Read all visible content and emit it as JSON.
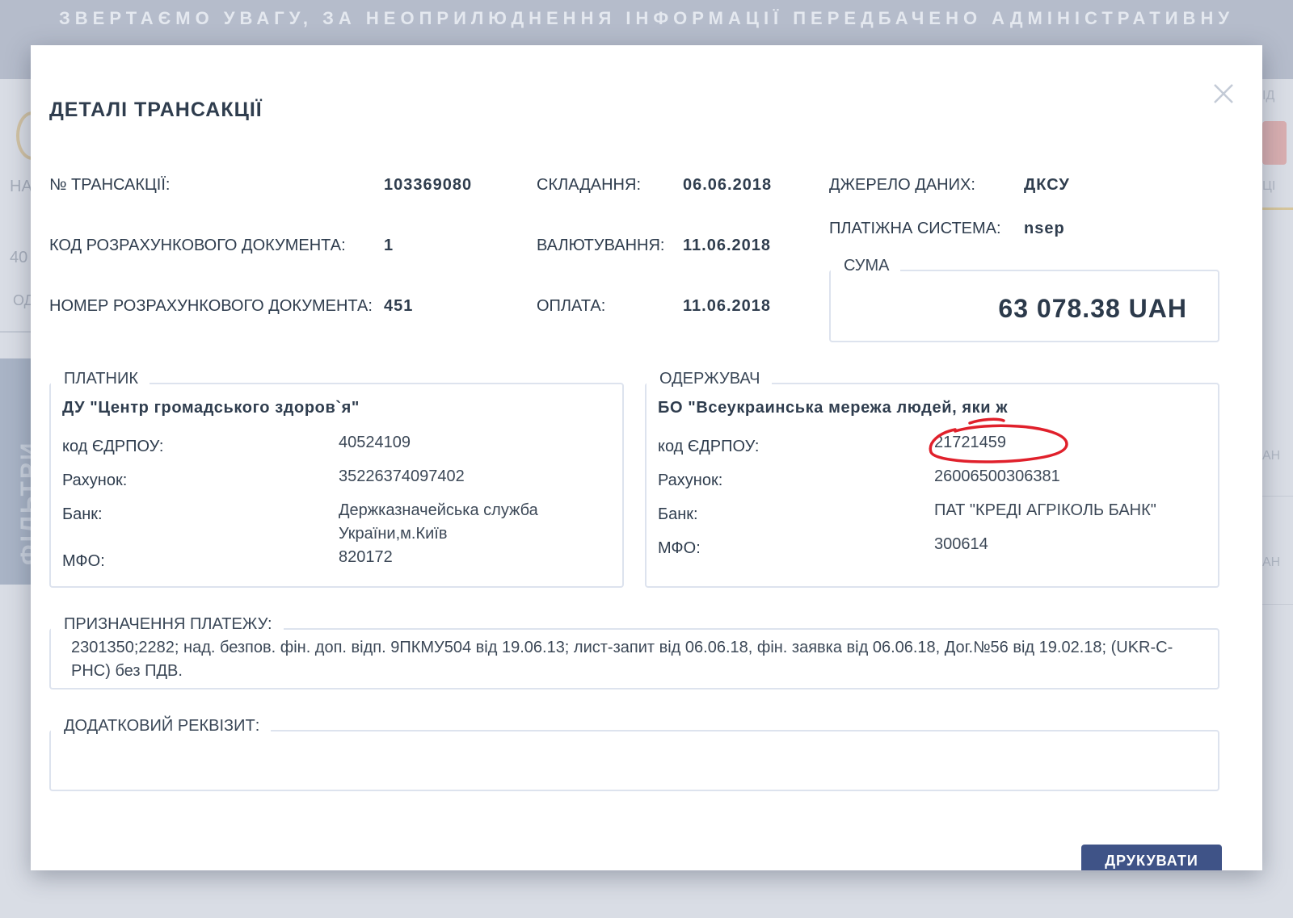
{
  "background": {
    "banner_text": "ЗВЕРТАЄМО УВАГУ, ЗА НЕОПРИЛЮДНЕННЯ ІНФОРМАЦІЇ ПЕРЕДБАЧЕНО АДМІНІСТРАТИВНУ",
    "filter_tab_label": "ФІЛЬТРИ",
    "left_snippets": [
      "НА",
      "40",
      "ОД"
    ],
    "right_snippets": [
      "ІД",
      "ЦІ",
      "АН",
      "АН"
    ]
  },
  "modal": {
    "title": "ДЕТАЛІ ТРАНСАКЦІЇ",
    "close_icon": "close-icon",
    "fields": {
      "transaction_no": {
        "label": "№ ТРАНСАКЦІЇ:",
        "value": "103369080"
      },
      "doc_code": {
        "label": "КОД РОЗРАХУНКОВОГО ДОКУМЕНТА:",
        "value": "1"
      },
      "doc_number": {
        "label": "НОМЕР РОЗРАХУНКОВОГО ДОКУМЕНТА:",
        "value": "451"
      },
      "drafted": {
        "label": "СКЛАДАННЯ:",
        "value": "06.06.2018"
      },
      "value_date": {
        "label": "ВАЛЮТУВАННЯ:",
        "value": "11.06.2018"
      },
      "payment": {
        "label": "ОПЛАТА:",
        "value": "11.06.2018"
      },
      "data_source": {
        "label": "ДЖЕРЕЛО ДАНИХ:",
        "value": "ДКСУ"
      },
      "payment_system": {
        "label": "ПЛАТІЖНА СИСТЕМА:",
        "value": "nsep"
      }
    },
    "amount": {
      "legend": "СУМА",
      "value": "63 078.38 UAH"
    },
    "payer": {
      "legend": "ПЛАТНИК",
      "name": "ДУ \"Центр громадського здоров`я\"",
      "edrpou_label": "код ЄДРПОУ:",
      "edrpou": "40524109",
      "account_label": "Рахунок:",
      "account": "35226374097402",
      "bank_label": "Банк:",
      "bank_line1": "Держказначейська служба",
      "bank_line2": "України,м.Київ",
      "mfo_label": "МФО:",
      "mfo": "820172"
    },
    "recipient": {
      "legend": "ОДЕРЖУВАЧ",
      "name": "БО \"Всеукраинська мережа людей, яки ж",
      "edrpou_label": "код ЄДРПОУ:",
      "edrpou": "21721459",
      "account_label": "Рахунок:",
      "account": "26006500306381",
      "bank_label": "Банк:",
      "bank": "ПАТ \"КРЕДІ АГРІКОЛЬ БАНК\"",
      "mfo_label": "МФО:",
      "mfo": "300614"
    },
    "purpose": {
      "legend": "ПРИЗНАЧЕННЯ ПЛАТЕЖУ:",
      "text": "2301350;2282; над. безпов. фін. доп. відп. 9ПКМУ504 від 19.06.13; лист-запит від 06.06.18, фін. заявка від 06.06.18, Дог.№56 від 19.02.18; (UKR-C-PHC) без ПДВ."
    },
    "additional": {
      "legend": "ДОДАТКОВИЙ РЕКВІЗИТ:",
      "text": ""
    },
    "print_button": "ДРУКУВАТИ"
  },
  "colors": {
    "modal_background": "#ffffff",
    "text": "#2f3d4e",
    "border": "#dde3ee",
    "button": "#3f5387",
    "highlight_mark": "#e0202b",
    "overlay": "#b5bccb"
  }
}
